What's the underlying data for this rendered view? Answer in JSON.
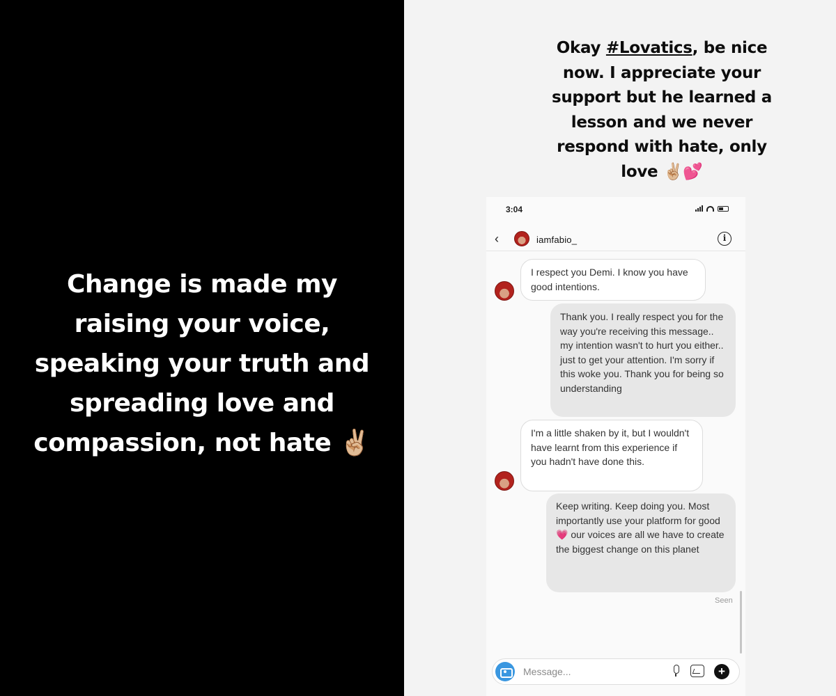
{
  "left_story": {
    "lines": [
      "Change is made my",
      "raising your voice,",
      "speaking your truth and",
      "spreading love and",
      "compassion, not hate ✌🏼"
    ]
  },
  "right_story": {
    "caption_parts": {
      "before": "Okay ",
      "hashtag": "#Lovatics",
      "after": ", be nice now. I appreciate your support but he learned a lesson and we never respond with hate, only love ✌🏼💕"
    }
  },
  "phone": {
    "status_time": "3:04",
    "header": {
      "username": "iamfabio_",
      "back_icon": "chevron-left-icon",
      "info_icon": "info-icon"
    },
    "messages": [
      {
        "direction": "in",
        "text": "I respect you Demi. I know you have good intentions."
      },
      {
        "direction": "out",
        "text": "Thank you. I really respect you for the way you're receiving this message.. my intention wasn't to hurt you either.. just to get your attention. I'm sorry if this woke you. Thank you for being so understanding"
      },
      {
        "direction": "in",
        "text": "I'm a little shaken by it, but I wouldn't have learnt from this experience if you hadn't have done this."
      },
      {
        "direction": "out",
        "parts": [
          "Keep writing. Keep doing you. Most importantly use your platform for good ",
          "💗",
          " our voices are all we have to create the biggest change on this planet"
        ]
      }
    ],
    "seen_label": "Seen",
    "composer": {
      "placeholder": "Message...",
      "icons": [
        "camera-icon",
        "microphone-icon",
        "gallery-icon",
        "plus-icon"
      ]
    }
  },
  "colors": {
    "left_background": "#000000",
    "right_background": "#f3f3f3",
    "outgoing_bubble": "#e7e7e7",
    "camera_blue": "#3a97e0"
  }
}
